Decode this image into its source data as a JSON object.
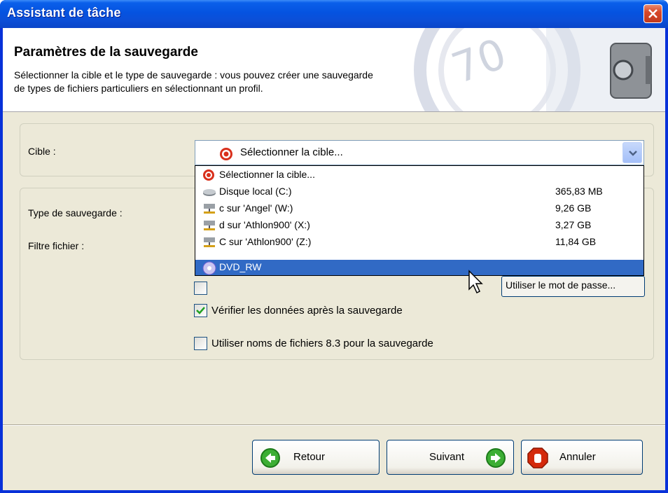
{
  "window": {
    "title": "Assistant de tâche",
    "close_icon": "close-icon"
  },
  "header": {
    "title": "Paramètres de la sauvegarde",
    "description": "Sélectionner la cible et le type de sauvegarde : vous pouvez créer une sauvegarde\nde types de fichiers particuliers en sélectionnant un profil.",
    "art_icon": "safe-icon"
  },
  "form": {
    "cible_label": "Cible :",
    "type_label": "Type de sauvegarde :",
    "filtre_label": "Filtre fichier :",
    "cible_value": "Sélectionner la cible...",
    "dropdown_items": [
      {
        "label": "Sélectionner la cible...",
        "size": "",
        "icon": "target-icon",
        "selected": false
      },
      {
        "label": "Disque local (C:)",
        "size": "365,83 MB",
        "icon": "hard-drive-icon",
        "selected": false
      },
      {
        "label": "c sur 'Angel' (W:)",
        "size": "9,26 GB",
        "icon": "network-drive-icon",
        "selected": false
      },
      {
        "label": "d sur 'Athlon900' (X:)",
        "size": "3,27 GB",
        "icon": "network-drive-icon",
        "selected": false
      },
      {
        "label": "C sur 'Athlon900' (Z:)",
        "size": "11,84 GB",
        "icon": "network-drive-icon",
        "selected": false
      },
      {
        "label": "DVD_RW",
        "size": "",
        "icon": "dvd-drive-icon",
        "selected": true
      }
    ],
    "password_button": "Utiliser le mot de passe...",
    "verify_label": "Vérifier les données après la sauvegarde",
    "verify_checked": true,
    "names83_label": "Utiliser noms de fichiers 8.3 pour la sauvegarde",
    "names83_checked": false
  },
  "footer": {
    "back_label": "Retour",
    "next_label": "Suivant",
    "cancel_label": "Annuler"
  },
  "colors": {
    "titlebar": "#0553e0",
    "selection": "#316ac5",
    "dialog_bg": "#ece9d8",
    "cancel_icon": "#d42a0c",
    "nav_icon": "#3cae34"
  }
}
